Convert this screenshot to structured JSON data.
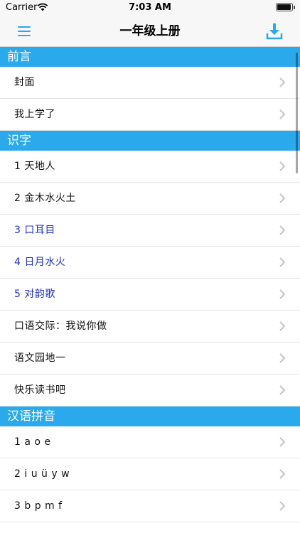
{
  "status": {
    "carrier": "Carrier",
    "time": "7:03 AM",
    "battery_level": 0.95
  },
  "nav": {
    "title": "一年级上册",
    "left_icon": "menu-icon",
    "right_icon": "download-icon"
  },
  "colors": {
    "section_header": "#2aa9ec",
    "accent": "#2aa9ec",
    "highlight_text": "#1c2fd6"
  },
  "sections": [
    {
      "title": "前言",
      "rows": [
        {
          "label": "封面",
          "highlight": false
        },
        {
          "label": "我上学了",
          "highlight": false
        }
      ]
    },
    {
      "title": "识字",
      "rows": [
        {
          "label": "1 天地人",
          "highlight": false
        },
        {
          "label": "2 金木水火土",
          "highlight": false
        },
        {
          "label": "3 口耳目",
          "highlight": true
        },
        {
          "label": "4 日月水火",
          "highlight": true
        },
        {
          "label": "5 对韵歌",
          "highlight": true
        },
        {
          "label": "口语交际：我说你做",
          "highlight": false
        },
        {
          "label": "语文园地一",
          "highlight": false
        },
        {
          "label": "快乐读书吧",
          "highlight": false
        }
      ]
    },
    {
      "title": "汉语拼音",
      "rows": [
        {
          "label": "1 a o e",
          "highlight": false
        },
        {
          "label": "2 i u ü y w",
          "highlight": false
        },
        {
          "label": "3 b p m f",
          "highlight": false
        }
      ]
    }
  ]
}
